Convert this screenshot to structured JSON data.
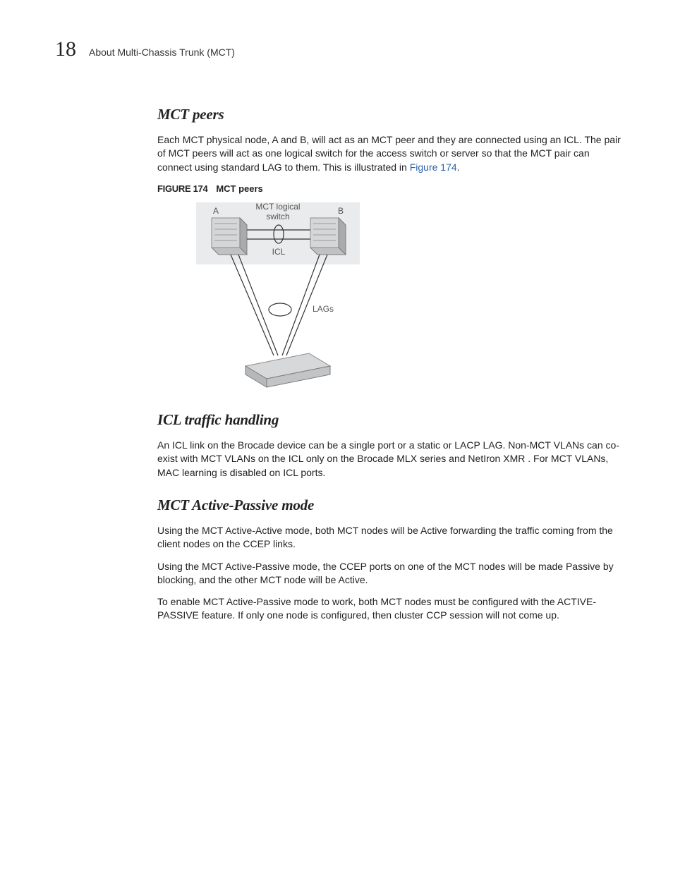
{
  "header": {
    "page_number": "18",
    "chapter_title": "About Multi-Chassis Trunk (MCT)"
  },
  "sections": {
    "mct_peers": {
      "heading": "MCT peers",
      "para1_a": "Each MCT physical node, A and B, will act as an MCT peer and they are connected using an ICL. The pair of MCT peers will act as one logical switch for the access switch or server so that the MCT pair can connect using standard LAG to them. This is illustrated in ",
      "para1_linktext": "Figure 174",
      "para1_b": ".",
      "figure_label": "FIGURE 174",
      "figure_title": "MCT peers",
      "diagram": {
        "label_top": "MCT logical switch",
        "label_a": "A",
        "label_b": "B",
        "label_icl": "ICL",
        "label_lags": "LAGs"
      }
    },
    "icl": {
      "heading": "ICL traffic handling",
      "para1": "An ICL link on the Brocade device can be a single port or a static or LACP LAG. Non-MCT VLANs can co-exist with MCT VLANs on the ICL only on the Brocade MLX series and NetIron XMR . For MCT VLANs, MAC learning is disabled on ICL ports."
    },
    "active_passive": {
      "heading": "MCT Active-Passive mode",
      "para1": "Using the MCT Active-Active mode, both MCT nodes will be Active forwarding the traffic coming from the client nodes on the CCEP links.",
      "para2": "Using the MCT Active-Passive mode, the CCEP ports on one of the MCT nodes will be made Passive by blocking, and the other MCT node will be Active.",
      "para3": "To enable MCT Active-Passive mode to work, both MCT nodes must be configured with the ACTIVE-PASSIVE feature. If only one node is configured, then cluster CCP session will not come up."
    }
  }
}
